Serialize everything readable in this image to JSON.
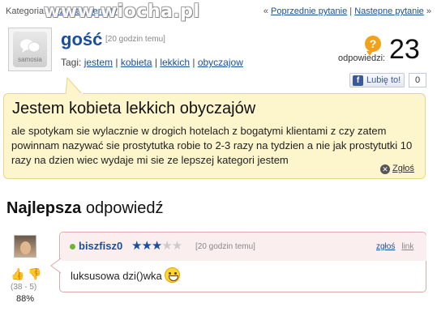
{
  "topbar": {
    "category_label": "Kategoria:",
    "category_link": "Pozostałe tematy",
    "prev_link": "Poprzednie pytanie",
    "separator": "|",
    "next_link": "Nastepne pytanie",
    "left_quote": "«",
    "right_quote": "»"
  },
  "watermark": "www.wiocha.pl",
  "question": {
    "avatar_label": "samosia",
    "author": "gość",
    "time": "[20 godzin temu]",
    "tags_label": "Tagi:",
    "tags": [
      "jestem",
      "kobieta",
      "lekkich",
      "obyczajow"
    ],
    "answers_label": "odpowiedzi:",
    "answers_count": "23",
    "like_label": "Lubię to!",
    "like_count": "0",
    "title": "Jestem kobieta lekkich obyczajów",
    "body": "ale spotykam sie wylacznie w drogich hotelach z bogatymi klientami z czy zatem powinnam nazywać sie prostytutka robie to 2-3 razy na tydzien a nie jak prostytutki 10 razy na dzien wiec wydaje mi sie ze lepszej kategori jestem",
    "report_label": "Zgłoś"
  },
  "best_answer": {
    "heading_bold": "Najlepsza",
    "heading_rest": "odpowiedź",
    "author": "biszfisz0",
    "rating": {
      "value": 3,
      "max": 5
    },
    "time": "[20 godzin temu]",
    "report_link": "zgłoś",
    "permalink": "link",
    "votes": "(38 - 5)",
    "percent": "88%",
    "body": "luksusowa dzi()wka"
  },
  "colors": {
    "link": "#1a4f9c",
    "question_bg": "#fdf5cc",
    "answer_header_bg": "#fbeeee",
    "question_icon": "#f2a11d"
  }
}
